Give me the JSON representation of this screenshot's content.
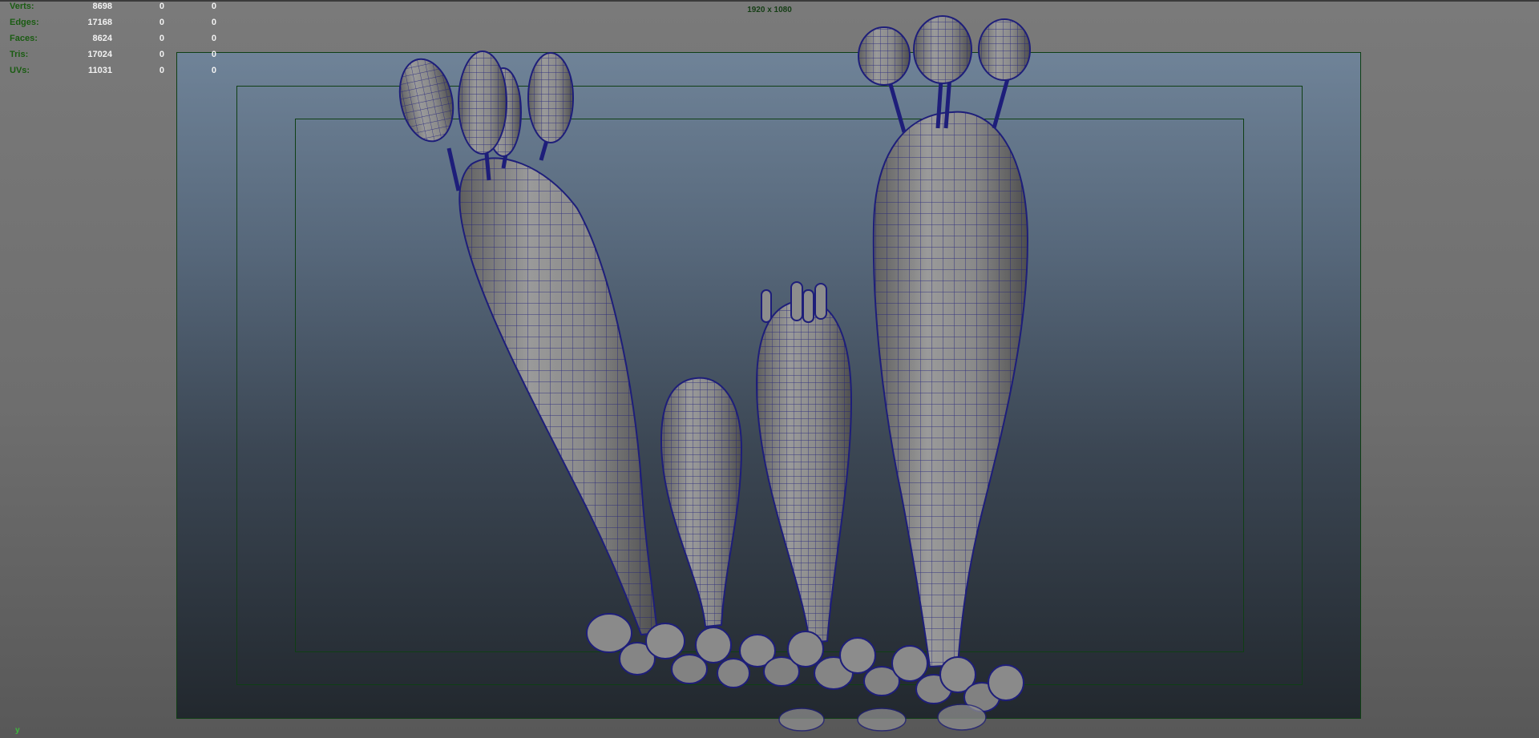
{
  "viewport": {
    "resolution_label": "1920 x 1080",
    "axis_label": "y"
  },
  "hud": {
    "rows": [
      {
        "label": "Verts:",
        "values": [
          "8698",
          "0",
          "0"
        ]
      },
      {
        "label": "Edges:",
        "values": [
          "17168",
          "0",
          "0"
        ]
      },
      {
        "label": "Faces:",
        "values": [
          "8624",
          "0",
          "0"
        ]
      },
      {
        "label": "Tris:",
        "values": [
          "17024",
          "0",
          "0"
        ]
      },
      {
        "label": "UVs:",
        "values": [
          "11031",
          "0",
          "0"
        ]
      }
    ]
  },
  "colors": {
    "hud_label": "#1a5c12",
    "hud_value": "#f2f2f2",
    "gate_border": "#0f3f14",
    "wireframe": "#1e1e7a",
    "mesh_fill": "#8d8d8d"
  }
}
